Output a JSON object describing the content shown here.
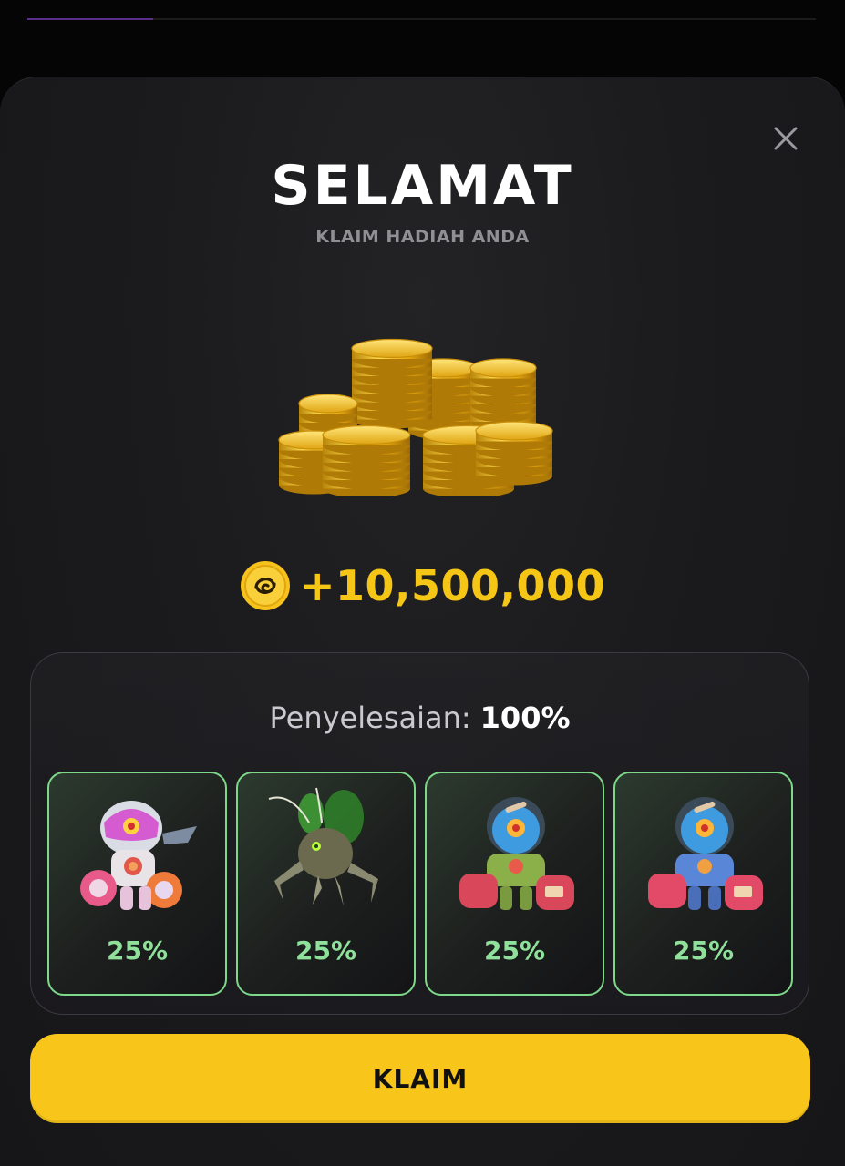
{
  "background": {
    "progress_fraction": 0.16
  },
  "modal": {
    "close_icon": "close-icon",
    "title": "SELAMAT",
    "subtitle": "KLAIM HADIAH ANDA",
    "illustration_icon": "gold-coins-stack-icon",
    "reward": {
      "icon": "coin-token-icon",
      "amount": "+10,500,000"
    },
    "completion": {
      "label": "Penyelesaian:",
      "value": "100%"
    },
    "characters": [
      {
        "icon": "pink-robot-astronaut-icon",
        "percent": "25%"
      },
      {
        "icon": "green-insect-drone-icon",
        "percent": "25%"
      },
      {
        "icon": "green-robot-astronaut-icon",
        "percent": "25%"
      },
      {
        "icon": "blue-robot-astronaut-icon",
        "percent": "25%"
      }
    ],
    "claim_label": "KLAIM"
  },
  "colors": {
    "accent": "#f8c51a",
    "reward_text": "#f6c617",
    "card_border": "#7dd88a",
    "card_percent": "#8fe09a",
    "background": "#1b1b1d"
  }
}
